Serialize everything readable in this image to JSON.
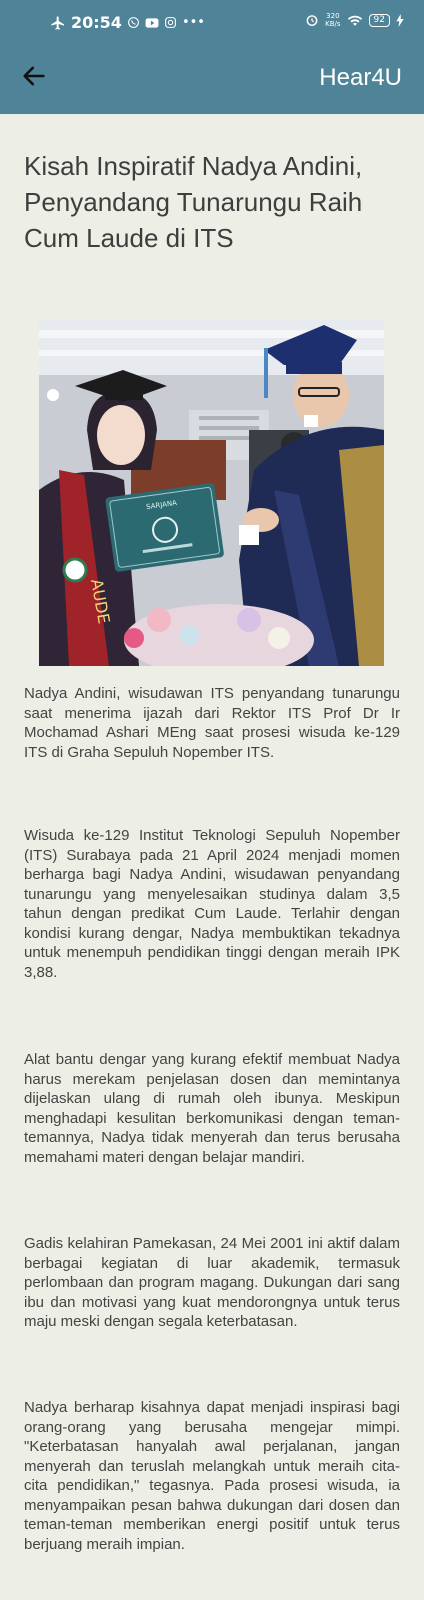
{
  "status_bar": {
    "time": "20:54",
    "speed_value": "320",
    "speed_unit": "KB/s",
    "battery": "92"
  },
  "app_bar": {
    "title": "Hear4U",
    "back_icon": "arrow-left-icon"
  },
  "article": {
    "title": "Kisah Inspiratif Nadya Andini, Penyandang Tunarungu Raih Cum Laude di ITS",
    "image_sign_text": "SARJANA",
    "image_sash_text": "AUDE",
    "paragraphs": [
      "Nadya Andini, wisudawan ITS penyandang tunarungu saat menerima ijazah dari Rektor ITS Prof Dr Ir Mochamad Ashari MEng saat prosesi wisuda ke-129 ITS di Graha Sepuluh Nopember ITS.",
      "Wisuda ke-129 Institut Teknologi Sepuluh Nopember (ITS) Surabaya pada 21 April 2024 menjadi momen berharga bagi Nadya Andini, wisudawan penyandang tunarungu yang menyelesaikan studinya dalam 3,5 tahun dengan predikat Cum Laude. Terlahir dengan kondisi kurang dengar, Nadya membuktikan tekadnya untuk menempuh pendidikan tinggi dengan meraih IPK 3,88.",
      "Alat bantu dengar yang kurang efektif membuat Nadya harus merekam penjelasan dosen dan memintanya dijelaskan ulang di rumah oleh ibunya. Meskipun menghadapi kesulitan berkomunikasi dengan teman-temannya, Nadya tidak menyerah dan terus berusaha memahami materi dengan belajar mandiri.",
      "Gadis kelahiran Pamekasan, 24 Mei 2001 ini aktif dalam berbagai kegiatan di luar akademik, termasuk perlombaan dan program magang. Dukungan dari sang ibu dan motivasi yang kuat mendorongnya untuk terus maju meski dengan segala keterbatasan.",
      "Nadya berharap kisahnya dapat menjadi inspirasi bagi orang-orang yang berusaha mengejar mimpi. \"Keterbatasan hanyalah awal perjalanan, jangan menyerah dan teruslah melangkah untuk meraih cita-cita pendidikan,\" tegasnya. Pada prosesi wisuda, ia menyampaikan pesan bahwa dukungan dari dosen dan teman-teman memberikan energi positif untuk terus berjuang meraih impian."
    ]
  },
  "colors": {
    "app_bar": "#4f8397",
    "background": "#edefe6",
    "text": "#444444"
  }
}
